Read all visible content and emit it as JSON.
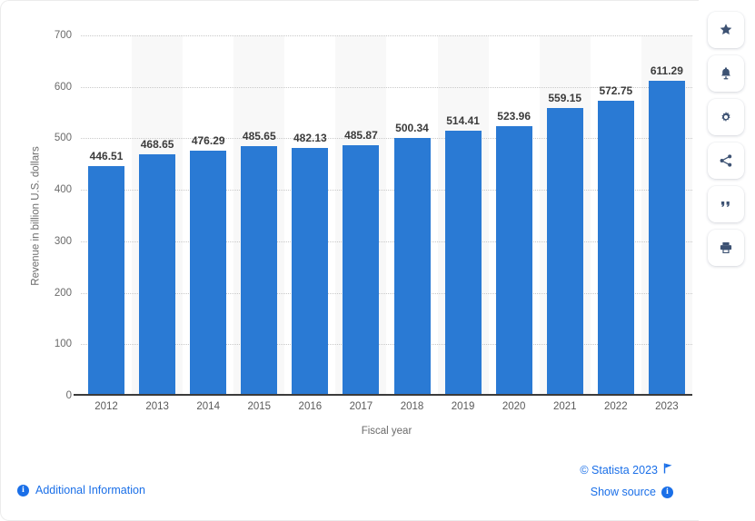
{
  "chart_data": {
    "type": "bar",
    "title": "",
    "subtitle": "",
    "xlabel": "Fiscal year",
    "ylabel": "Revenue in billion U.S. dollars",
    "categories": [
      "2012",
      "2013",
      "2014",
      "2015",
      "2016",
      "2017",
      "2018",
      "2019",
      "2020",
      "2021",
      "2022",
      "2023"
    ],
    "values": [
      446.51,
      468.65,
      476.29,
      485.65,
      482.13,
      485.87,
      500.34,
      514.41,
      523.96,
      559.15,
      572.75,
      611.29
    ],
    "value_labels": [
      "446.51",
      "468.65",
      "476.29",
      "485.65",
      "482.13",
      "485.87",
      "500.34",
      "514.41",
      "523.96",
      "559.15",
      "572.75",
      "611.29"
    ],
    "ylim": [
      0,
      700
    ],
    "yticks": [
      0,
      100,
      200,
      300,
      400,
      500,
      600,
      700
    ],
    "ytick_labels": [
      "0",
      "100",
      "200",
      "300",
      "400",
      "500",
      "600",
      "700"
    ],
    "grid": true,
    "legend": "none",
    "series": [
      {
        "name": "Revenue",
        "color": "#2a7ad4",
        "values": [
          446.51,
          468.65,
          476.29,
          485.65,
          482.13,
          485.87,
          500.34,
          514.41,
          523.96,
          559.15,
          572.75,
          611.29
        ]
      }
    ]
  },
  "footer": {
    "additional_information": "Additional Information",
    "copyright": "© Statista 2023",
    "show_source": "Show source",
    "info_glyph": "i",
    "flag_icon": "flag-icon",
    "link_color": "#1a6fe8"
  },
  "toolbar": {
    "items": [
      {
        "name": "favorite-button",
        "icon": "star-icon"
      },
      {
        "name": "alert-button",
        "icon": "bell-icon"
      },
      {
        "name": "settings-button",
        "icon": "gear-icon"
      },
      {
        "name": "share-button",
        "icon": "share-icon"
      },
      {
        "name": "cite-button",
        "icon": "quote-icon"
      },
      {
        "name": "print-button",
        "icon": "print-icon"
      }
    ],
    "icon_color": "#3d5273"
  },
  "theme": {
    "bar_color": "#2a7ad4",
    "band_color": "#f8f8f8",
    "grid_color": "#c9c9c9",
    "axis_color": "#3b3b3b",
    "label_color": "#3b3b3b",
    "tick_color": "#6b6b6b"
  }
}
